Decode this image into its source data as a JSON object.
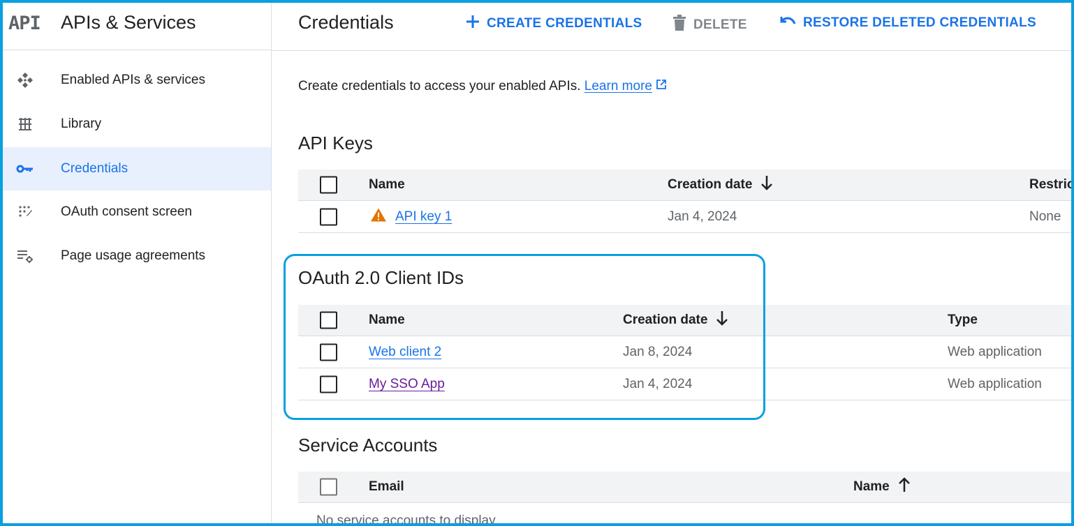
{
  "sidebar": {
    "logo": "API",
    "title": "APIs & Services",
    "items": [
      {
        "label": "Enabled APIs & services",
        "icon": "enabled-apis-icon"
      },
      {
        "label": "Library",
        "icon": "library-icon"
      },
      {
        "label": "Credentials",
        "icon": "key-icon",
        "active": true
      },
      {
        "label": "OAuth consent screen",
        "icon": "oauth-consent-icon"
      },
      {
        "label": "Page usage agreements",
        "icon": "settings-list-icon"
      }
    ]
  },
  "topbar": {
    "title": "Credentials",
    "create_label": "CREATE CREDENTIALS",
    "delete_label": "DELETE",
    "restore_label": "RESTORE DELETED CREDENTIALS"
  },
  "intro": {
    "text": "Create credentials to access your enabled APIs.",
    "link": "Learn more"
  },
  "api_keys": {
    "title": "API Keys",
    "headers": {
      "name": "Name",
      "creation_date": "Creation date",
      "restrictions": "Restric"
    },
    "rows": [
      {
        "name": "API key 1",
        "date": "Jan 4, 2024",
        "restrictions": "None",
        "warning": true
      }
    ]
  },
  "oauth": {
    "title": "OAuth 2.0 Client IDs",
    "headers": {
      "name": "Name",
      "creation_date": "Creation date",
      "type": "Type"
    },
    "rows": [
      {
        "name": "Web client 2",
        "date": "Jan 8, 2024",
        "type": "Web application"
      },
      {
        "name": "My SSO App",
        "date": "Jan 4, 2024",
        "type": "Web application"
      }
    ]
  },
  "service_accounts": {
    "title": "Service Accounts",
    "headers": {
      "email": "Email",
      "name": "Name"
    },
    "empty": "No service accounts to display"
  },
  "colors": {
    "accent": "#1a73e8",
    "highlight": "#0aa0e0",
    "warning": "#e37400",
    "visited_link": "#6a1b9a"
  }
}
